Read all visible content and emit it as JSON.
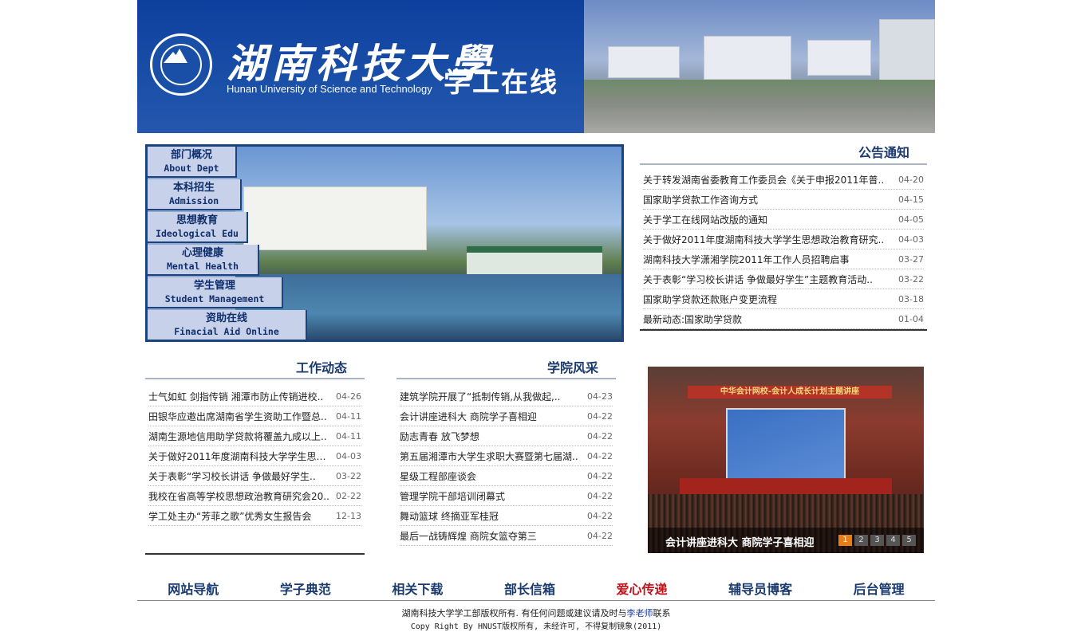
{
  "header": {
    "logo_cn": "湖南科技大學",
    "logo_en": "Hunan University of Science and Technology",
    "subtitle": "学工在线"
  },
  "nav": [
    {
      "cn": "部门概况",
      "en": "About Dept"
    },
    {
      "cn": "本科招生",
      "en": "Admission"
    },
    {
      "cn": "思想教育",
      "en": "Ideological Edu"
    },
    {
      "cn": "心理健康",
      "en": "Mental Health"
    },
    {
      "cn": "学生管理",
      "en": "Student Management"
    },
    {
      "cn": "资助在线",
      "en": "Finacial Aid Online"
    }
  ],
  "notice": {
    "title": "公告通知",
    "items": [
      {
        "title": "关于转发湖南省委教育工作委员会《关于申报2011年普..",
        "date": "04-20"
      },
      {
        "title": "国家助学贷款工作咨询方式",
        "date": "04-15"
      },
      {
        "title": "关于学工在线网站改版的通知",
        "date": "04-05"
      },
      {
        "title": "关于做好2011年度湖南科技大学学生思想政治教育研究..",
        "date": "04-03"
      },
      {
        "title": "湖南科技大学潇湘学院2011年工作人员招聘启事",
        "date": "03-27"
      },
      {
        "title": "关于表彰“学习校长讲话 争做最好学生”主题教育活动..",
        "date": "03-22"
      },
      {
        "title": "国家助学贷款还款账户变更流程",
        "date": "03-18"
      },
      {
        "title": "最新动态:国家助学贷款",
        "date": "01-04"
      }
    ]
  },
  "work": {
    "title": "工作动态",
    "items": [
      {
        "title": "士气如虹 剑指传销 湘潭市防止传销进校..",
        "date": "04-26"
      },
      {
        "title": "田银华应邀出席湖南省学生资助工作暨总..",
        "date": "04-11"
      },
      {
        "title": "湖南生源地信用助学贷款将覆盖九成以上..",
        "date": "04-11"
      },
      {
        "title": "关于做好2011年度湖南科技大学学生思想..",
        "date": "04-03"
      },
      {
        "title": "关于表彰“学习校长讲话 争做最好学生..",
        "date": "03-22"
      },
      {
        "title": "我校在省高等学校思想政治教育研究会20..",
        "date": "02-22"
      },
      {
        "title": "学工处主办“芳菲之歌”优秀女生报告会",
        "date": "12-13"
      }
    ]
  },
  "college": {
    "title": "学院风采",
    "items": [
      {
        "title": "建筑学院开展了“抵制传销,从我做起,..",
        "date": "04-23"
      },
      {
        "title": "会计讲座进科大 商院学子喜相迎",
        "date": "04-22"
      },
      {
        "title": "励志青春 放飞梦想",
        "date": "04-22"
      },
      {
        "title": "第五届湘潭市大学生求职大赛暨第七届湖..",
        "date": "04-22"
      },
      {
        "title": "星级工程部座谈会",
        "date": "04-22"
      },
      {
        "title": "管理学院干部培训闭幕式",
        "date": "04-22"
      },
      {
        "title": "舞动篮球 终摘亚军桂冠",
        "date": "04-22"
      },
      {
        "title": "最后一战铸辉煌 商院女篮夺第三",
        "date": "04-22"
      }
    ]
  },
  "slideshow": {
    "banner": "中华会计网校-会计人成长计划主题讲座",
    "caption": "会计讲座进科大 商院学子喜相迎",
    "pages": [
      "1",
      "2",
      "3",
      "4",
      "5"
    ],
    "active_page": "1"
  },
  "bottom_nav": [
    "网站导航",
    "学子典范",
    "相关下载",
    "部长信箱",
    "爱心传递",
    "辅导员博客",
    "后台管理"
  ],
  "footer": {
    "line1_pre": "湖南科技大学学工部版权所有. 有任何问题或建议请及时与",
    "line1_link": "李老师",
    "line1_post": "联系",
    "line2": "Copy Right By HNUST版权所有, 未经许可, 不得复制镜象(2011)"
  },
  "colors": {
    "banner": "#1a4fa8",
    "nav_text": "#0f2e6b",
    "section_title": "#1a3a6e",
    "highlight": "#c0121b",
    "pager_active": "#e87c16"
  }
}
